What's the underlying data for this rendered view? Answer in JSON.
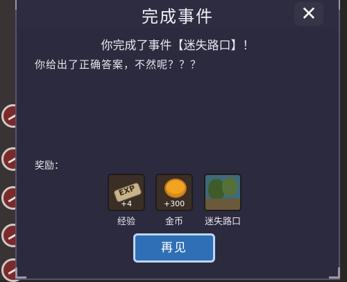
{
  "dialog": {
    "title": "完成事件",
    "close_symbol": "✕",
    "subtitle": "你完成了事件【迷失路口】！",
    "body": "你给出了正确答案，不然呢？？？",
    "reward_label": "奖励：",
    "rewards": [
      {
        "name": "经验",
        "count": "+4",
        "icon": "exp-scroll-icon"
      },
      {
        "name": "金币",
        "count": "+300",
        "icon": "gold-coin-icon"
      },
      {
        "name": "迷失路口",
        "count": "",
        "icon": "event-scene-icon"
      }
    ],
    "confirm_label": "再见",
    "exp_icon_text": "EXP"
  },
  "colors": {
    "panel": "#2c2a3e",
    "button": "#2f6fb5",
    "text": "#e8e6ee"
  }
}
